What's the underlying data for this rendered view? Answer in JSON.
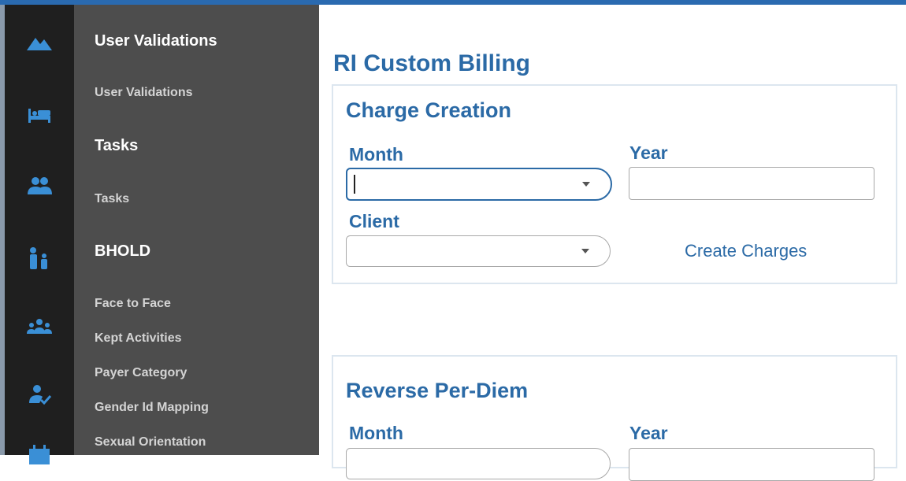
{
  "sidebar": {
    "sections": [
      {
        "title": "User Validations",
        "items": [
          "User Validations"
        ]
      },
      {
        "title": "Tasks",
        "items": [
          "Tasks"
        ]
      },
      {
        "title": "BHOLD",
        "items": [
          "Face to Face",
          "Kept Activities",
          "Payer Category",
          "Gender Id Mapping",
          "Sexual Orientation"
        ]
      }
    ],
    "rail_icons": [
      "landscape-icon",
      "bed-icon",
      "group-icon",
      "family-icon",
      "community-icon",
      "person-check-icon",
      "calendar-icon"
    ]
  },
  "page": {
    "title": "RI Custom Billing",
    "charge_creation": {
      "title": "Charge Creation",
      "month_label": "Month",
      "month_value": "",
      "year_label": "Year",
      "year_value": "",
      "client_label": "Client",
      "client_value": "",
      "create_charges_label": "Create Charges"
    },
    "reverse_per_diem": {
      "title": "Reverse Per-Diem",
      "month_label": "Month",
      "year_label": "Year"
    }
  },
  "colors": {
    "accent": "#2b6aa6",
    "rail": "#1f1f1f",
    "menu": "#4d4d4d",
    "panel_border": "#dce6ef"
  }
}
